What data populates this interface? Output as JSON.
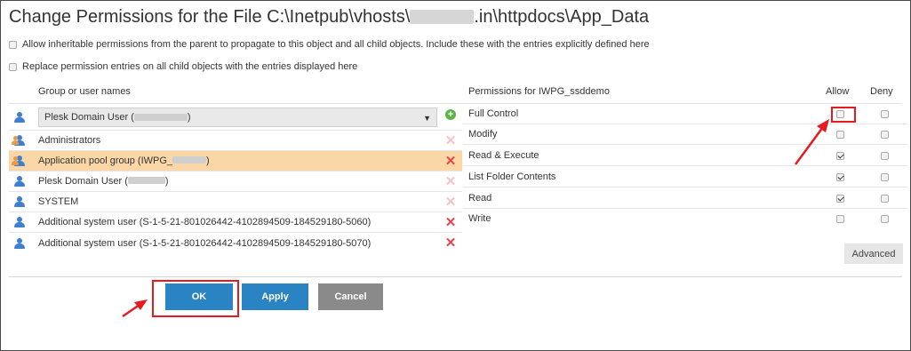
{
  "dialog": {
    "title_prefix": "Change Permissions for the File C:\\Inetpub\\vhosts\\",
    "title_suffix": ".in\\httpdocs\\App_Data"
  },
  "options": [
    {
      "label": "Allow inheritable permissions from the parent to propagate to this object and all child objects. Include these with the entries explicitly defined here",
      "checked": false
    },
    {
      "label": "Replace permission entries on all child objects with the entries displayed here",
      "checked": false
    }
  ],
  "groups": {
    "header": "Group or user names",
    "select_value_prefix": "Plesk Domain User (",
    "select_value_suffix": ")",
    "items": [
      {
        "label": "Administrators",
        "removable": false,
        "icon": "group-icon"
      },
      {
        "label_prefix": "Application pool group (IWPG_",
        "label_suffix": ")",
        "removable": true,
        "selected": true,
        "icon": "group-icon"
      },
      {
        "label_prefix": "Plesk Domain User (",
        "label_suffix": ")",
        "removable": false,
        "icon": "user-icon"
      },
      {
        "label": "SYSTEM",
        "removable": false,
        "icon": "user-icon"
      },
      {
        "label": "Additional system user (S-1-5-21-801026442-4102894509-184529180-5060)",
        "removable": true,
        "icon": "user-icon"
      },
      {
        "label": "Additional system user (S-1-5-21-801026442-4102894509-184529180-5070)",
        "removable": true,
        "icon": "user-icon"
      }
    ]
  },
  "permissions": {
    "header": "Permissions for IWPG_ssddemo",
    "allow_header": "Allow",
    "deny_header": "Deny",
    "items": [
      {
        "label": "Full Control",
        "allow": false,
        "deny": false
      },
      {
        "label": "Modify",
        "allow": false,
        "deny": false
      },
      {
        "label": "Read & Execute",
        "allow": true,
        "deny": false
      },
      {
        "label": "List Folder Contents",
        "allow": true,
        "deny": false
      },
      {
        "label": "Read",
        "allow": true,
        "deny": false
      },
      {
        "label": "Write",
        "allow": false,
        "deny": false
      }
    ],
    "advanced_label": "Advanced"
  },
  "buttons": {
    "ok": "OK",
    "apply": "Apply",
    "cancel": "Cancel"
  },
  "colors": {
    "primary": "#2a84c4",
    "selected_row": "#fbd7a8",
    "highlight": "#e8191f"
  }
}
